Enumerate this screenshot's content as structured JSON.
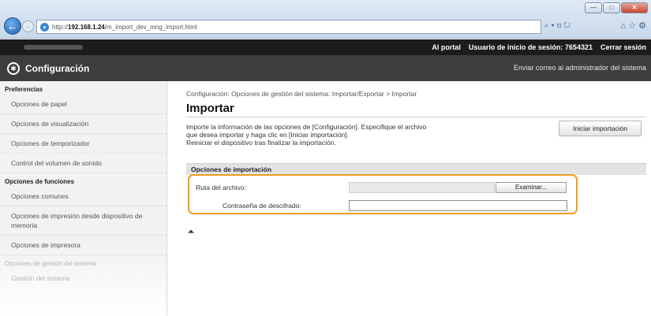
{
  "browser": {
    "url_prefix": "http://",
    "url_host": "192.168.1.24",
    "url_path": "/m_import_dev_mng_import.html",
    "search_glyph": "⌕ ▾ ⊡ ↻",
    "home_glyph": "⌂ ☆ ⚙",
    "win_minimize": "—",
    "win_maximize": "□",
    "win_close": "✕"
  },
  "topbar": {
    "portal": "Al portal",
    "login_label": "Usuario de inicio de sesión:",
    "login_user": "7654321",
    "logout": "Cerrar sesión"
  },
  "header": {
    "title": "Configuración",
    "mail": "Enviar correo al administrador del sistema"
  },
  "sidebar": {
    "section_preferences": "Preferencias",
    "items_preferences": [
      "Opciones de papel",
      "Opciones de visualización",
      "Opciones de temporizador",
      "Control del volumen de sonido"
    ],
    "section_functions": "Opciones de funciones",
    "items_functions": [
      "Opciones comunes",
      "Opciones de impresión desde dispositivo de memoria",
      "Opciones de impresora"
    ],
    "section_system": "Opciones de gestión del sistema",
    "item_system": "Gestión del sistema"
  },
  "main": {
    "breadcrumb": "Configuración: Opciones de gestión del sistema: Importar/Exportar > Importar",
    "title": "Importar",
    "desc_line1": "Importe la información de las opciones de [Configuración]. Especifique el archivo",
    "desc_line2": "que desea importar y haga clic en [Iniciar importación].",
    "desc_line3": "Reiniciar el dispositivo tras finalizar la importación.",
    "start_button": "Iniciar importación",
    "section_title": "Opciones de importación",
    "file_path_label": "Ruta del archivo:",
    "browse_button": "Examinar...",
    "password_label": "Contraseña de descifrado:",
    "top_link": "⏶"
  }
}
